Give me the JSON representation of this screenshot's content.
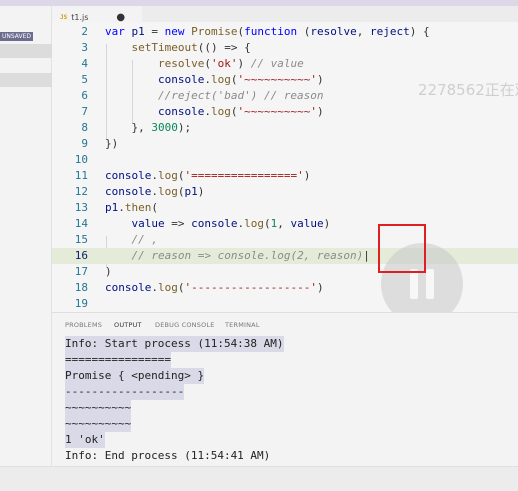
{
  "sidebar": {
    "unsaved_badge": "UNSAVED"
  },
  "tab": {
    "js_icon": "JS",
    "filename": "t1.js",
    "modified_dot": "●"
  },
  "editor": {
    "lines": [
      {
        "n": "2",
        "tokens": [
          [
            "k",
            "var "
          ],
          [
            "p",
            "p1"
          ],
          [
            "t",
            " = "
          ],
          [
            "k",
            "new "
          ],
          [
            "f",
            "Promise"
          ],
          [
            "t",
            "("
          ],
          [
            "k",
            "function"
          ],
          [
            "t",
            " ("
          ],
          [
            "p",
            "resolve"
          ],
          [
            "t",
            ", "
          ],
          [
            "p",
            "reject"
          ],
          [
            "t",
            ") {"
          ]
        ]
      },
      {
        "n": "3",
        "tokens": [
          [
            "t",
            "    "
          ],
          [
            "f",
            "setTimeout"
          ],
          [
            "t",
            "(() => {"
          ]
        ]
      },
      {
        "n": "4",
        "tokens": [
          [
            "t",
            "        "
          ],
          [
            "f",
            "resolve"
          ],
          [
            "t",
            "("
          ],
          [
            "s",
            "'ok'"
          ],
          [
            "t",
            ") "
          ],
          [
            "c",
            "// value"
          ]
        ]
      },
      {
        "n": "5",
        "tokens": [
          [
            "t",
            "        "
          ],
          [
            "p",
            "console"
          ],
          [
            "t",
            "."
          ],
          [
            "f",
            "log"
          ],
          [
            "t",
            "("
          ],
          [
            "s",
            "'~~~~~~~~~~'"
          ],
          [
            "t",
            ")"
          ]
        ]
      },
      {
        "n": "6",
        "tokens": [
          [
            "t",
            "        "
          ],
          [
            "c",
            "//reject('bad') // reason"
          ]
        ]
      },
      {
        "n": "7",
        "tokens": [
          [
            "t",
            "        "
          ],
          [
            "p",
            "console"
          ],
          [
            "t",
            "."
          ],
          [
            "f",
            "log"
          ],
          [
            "t",
            "("
          ],
          [
            "s",
            "'~~~~~~~~~~'"
          ],
          [
            "t",
            ")"
          ]
        ]
      },
      {
        "n": "8",
        "tokens": [
          [
            "t",
            "    }, "
          ],
          [
            "n",
            "3000"
          ],
          [
            "t",
            ");"
          ]
        ]
      },
      {
        "n": "9",
        "tokens": [
          [
            "t",
            "})"
          ]
        ]
      },
      {
        "n": "10",
        "tokens": []
      },
      {
        "n": "11",
        "tokens": [
          [
            "p",
            "console"
          ],
          [
            "t",
            "."
          ],
          [
            "f",
            "log"
          ],
          [
            "t",
            "("
          ],
          [
            "s",
            "'================'"
          ],
          [
            "t",
            ")"
          ]
        ]
      },
      {
        "n": "12",
        "tokens": [
          [
            "p",
            "console"
          ],
          [
            "t",
            "."
          ],
          [
            "f",
            "log"
          ],
          [
            "t",
            "("
          ],
          [
            "p",
            "p1"
          ],
          [
            "t",
            ")"
          ]
        ]
      },
      {
        "n": "13",
        "tokens": [
          [
            "p",
            "p1"
          ],
          [
            "t",
            "."
          ],
          [
            "f",
            "then"
          ],
          [
            "t",
            "("
          ]
        ]
      },
      {
        "n": "14",
        "tokens": [
          [
            "t",
            "    "
          ],
          [
            "p",
            "value"
          ],
          [
            "t",
            " => "
          ],
          [
            "p",
            "console"
          ],
          [
            "t",
            "."
          ],
          [
            "f",
            "log"
          ],
          [
            "t",
            "("
          ],
          [
            "n",
            "1"
          ],
          [
            "t",
            ", "
          ],
          [
            "p",
            "value"
          ],
          [
            "t",
            ")"
          ]
        ]
      },
      {
        "n": "15",
        "tokens": [
          [
            "t",
            "    "
          ],
          [
            "c",
            "// ,"
          ]
        ]
      },
      {
        "n": "16",
        "tokens": [
          [
            "t",
            "    "
          ],
          [
            "c",
            "// reason => console.log(2, reason)"
          ],
          [
            "t",
            "|"
          ]
        ]
      },
      {
        "n": "17",
        "tokens": [
          [
            "t",
            ")"
          ]
        ]
      },
      {
        "n": "18",
        "tokens": [
          [
            "p",
            "console"
          ],
          [
            "t",
            "."
          ],
          [
            "f",
            "log"
          ],
          [
            "t",
            "("
          ],
          [
            "s",
            "'------------------'"
          ],
          [
            "t",
            ")"
          ]
        ]
      },
      {
        "n": "19",
        "tokens": []
      }
    ]
  },
  "overlay": {
    "watermark": "2278562正在观"
  },
  "panel": {
    "tabs": [
      "PROBLEMS",
      "OUTPUT",
      "DEBUG CONSOLE",
      "TERMINAL"
    ],
    "output": [
      {
        "text": "Info: Start process (11:54:38 AM)",
        "hl": true
      },
      {
        "text": "================",
        "hl": true
      },
      {
        "text": "Promise { <pending> }",
        "hl": true
      },
      {
        "text": "------------------",
        "hl": true
      },
      {
        "text": "~~~~~~~~~~",
        "hl": true
      },
      {
        "text": "~~~~~~~~~~",
        "hl": true
      },
      {
        "text": "1 'ok'",
        "hl": true
      },
      {
        "text": "Info: End process (11:54:41 AM)",
        "hl": false
      }
    ]
  },
  "colors": {
    "keyword": "#0000ff",
    "function": "#795e26",
    "string": "#a31515",
    "comment": "#8a8a8a",
    "variable": "#001080",
    "number": "#098658",
    "line_number": "#237893"
  }
}
